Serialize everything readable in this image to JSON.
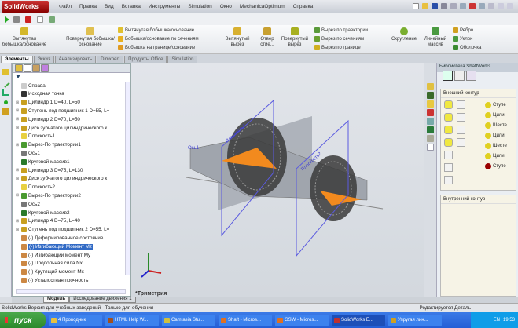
{
  "app": {
    "logo": "SolidWorks",
    "menu": [
      "Файл",
      "Правка",
      "Вид",
      "Вставка",
      "Инструменты",
      "Simulation",
      "Окно",
      "MechanicaOptimum",
      "Справка"
    ]
  },
  "commands": {
    "big": [
      "Вытянутая бобышка/основание",
      "Повернутая бобышка/основание",
      "Вытянутый вырез",
      "Отвер стие...",
      "Повернутый вырез",
      "Скругление",
      "Линейный массив"
    ],
    "small": [
      "Вытянутая бобышка/основание",
      "Бобышка/основание по сечениям",
      "Бобышка на границе/основание",
      "Вырез по траектории",
      "Вырез по сечениям",
      "Вырез по границе",
      "Ребро",
      "Уклон",
      "Оболочка"
    ]
  },
  "tabs": [
    "Элементы",
    "Эскиз",
    "Анализировать",
    "Dimxpert",
    "Продукты Office",
    "Simulation"
  ],
  "tree": [
    {
      "label": "Справа",
      "exp": false
    },
    {
      "label": "Исходная точка",
      "exp": false
    },
    {
      "label": "Цилиндр 1 D=40, L=50",
      "exp": true
    },
    {
      "label": "Ступень под подшипник 1 D=55, L=",
      "exp": true
    },
    {
      "label": "Цилиндр 2 D=70, L=50",
      "exp": true
    },
    {
      "label": "Диск зубчатого цилиндрического к",
      "exp": true
    },
    {
      "label": "Плоскость1",
      "exp": false
    },
    {
      "label": "Вырез-По траектории1",
      "exp": true
    },
    {
      "label": "Ось1",
      "exp": false
    },
    {
      "label": "Круговой массив1",
      "exp": false
    },
    {
      "label": "Цилиндр 3 D=75, L=130",
      "exp": true
    },
    {
      "label": "Диск зубчатого цилиндрического к",
      "exp": true
    },
    {
      "label": "Плоскость2",
      "exp": false
    },
    {
      "label": "Вырез-По траектории2",
      "exp": true
    },
    {
      "label": "Ось2",
      "exp": false
    },
    {
      "label": "Круговой массив2",
      "exp": false
    },
    {
      "label": "Цилиндр 4 D=75, L=40",
      "exp": true
    },
    {
      "label": "Ступень под подшипник 2 D=55, L=",
      "exp": true
    },
    {
      "label": "(-) Деформированное состояние",
      "exp": false
    },
    {
      "label": "(-) Изгибающий Момент Mz",
      "exp": false,
      "selected": true
    },
    {
      "label": "(-) Изгибающий момент My",
      "exp": false
    },
    {
      "label": "(-) Продольная сила  Nx",
      "exp": false
    },
    {
      "label": "(-) Крутящий момент  Mx",
      "exp": false
    },
    {
      "label": "(-) Усталостная прочность",
      "exp": false
    }
  ],
  "viewport": {
    "view_label": "*Триметрия",
    "plane_labels": [
      "Плоскость1",
      "Плоскость2"
    ],
    "axis_label": "Ось1"
  },
  "taskpane": {
    "title": "Библиотека ShaftWorks",
    "outer": "Внешний контур",
    "inner": "Внутренний контур",
    "items": [
      "Ступе",
      "Цили",
      "Шесте",
      "Цили",
      "Шесте",
      "Цили",
      "Ступе"
    ]
  },
  "bottom_tabs": [
    "Модель",
    "Исследование движения 1"
  ],
  "status": {
    "left": "SolidWorks Версия для учебных заведений - Только для обучения",
    "right": "Редактируется Деталь"
  },
  "taskbar": {
    "start": "пуск",
    "items": [
      "4 Проводник",
      "HTML Help W...",
      "Camtasia Stu...",
      "Shaft - Micros...",
      "GSW - Micros...",
      "SolidWorks E...",
      "Упругая лин..."
    ],
    "active": 5,
    "lang": "EN",
    "time": "19:53"
  },
  "colors": {
    "accent_orange": "#f28a1e",
    "plane_blue": "#5a5ae0",
    "selection": "#316ac5"
  }
}
